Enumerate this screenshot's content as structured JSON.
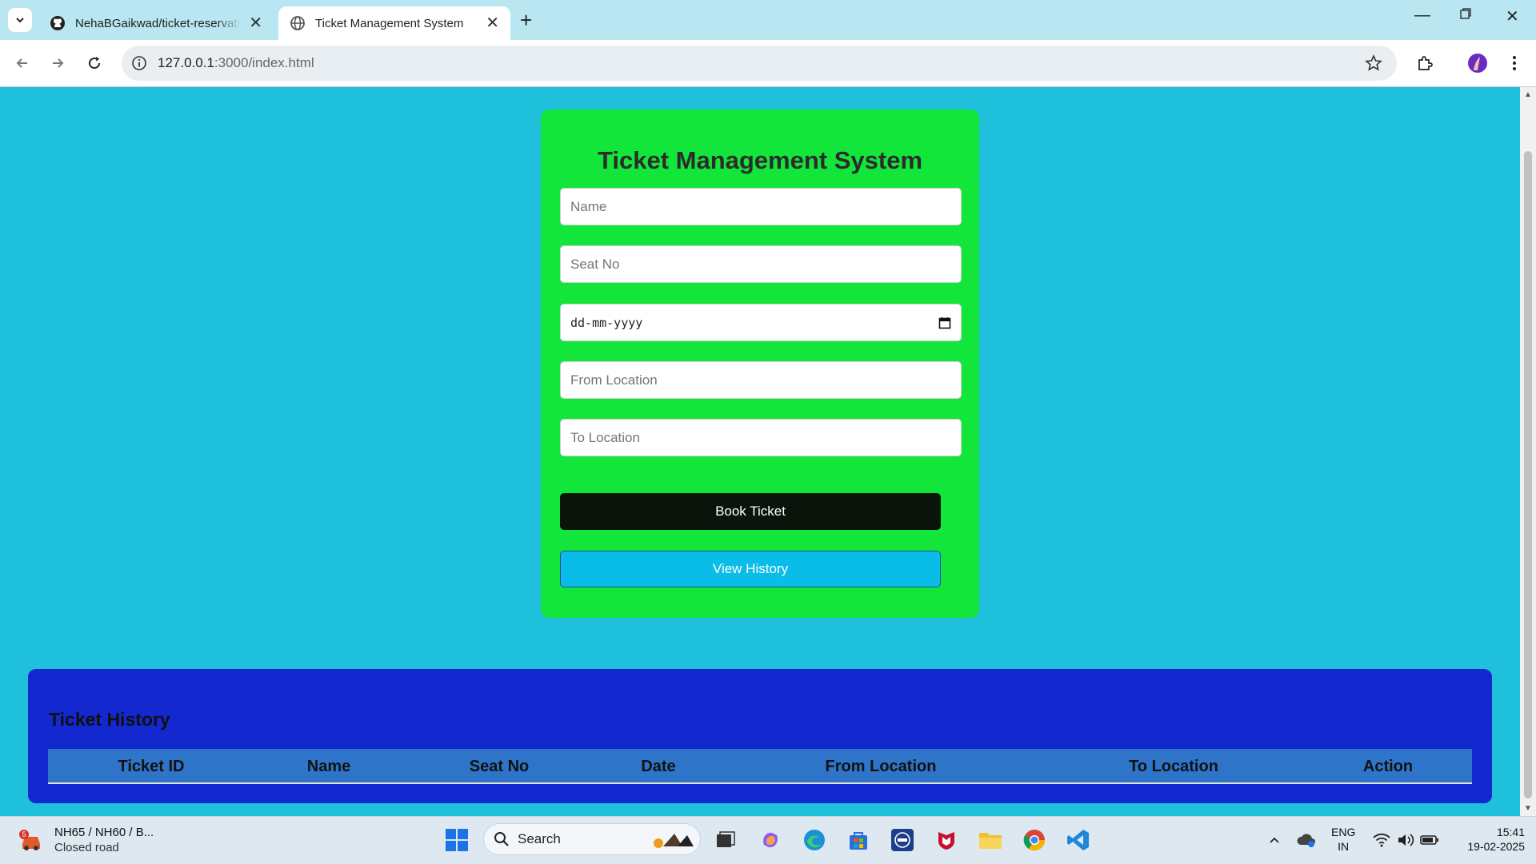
{
  "browser": {
    "tabs": [
      {
        "title": "NehaBGaikwad/ticket-reservatio",
        "active": false,
        "icon": "github-icon"
      },
      {
        "title": "Ticket Management System",
        "active": true,
        "icon": "globe-icon"
      }
    ],
    "address": {
      "host": "127.0.0.1",
      "path": ":3000/index.html"
    }
  },
  "form": {
    "title": "Ticket Management System",
    "name_placeholder": "Name",
    "seat_placeholder": "Seat No",
    "date_placeholder": "dd-mm-yyyy",
    "from_placeholder": "From Location",
    "to_placeholder": "To Location",
    "book_label": "Book Ticket",
    "history_label": "View History"
  },
  "history": {
    "title": "Ticket History",
    "columns": [
      "Ticket ID",
      "Name",
      "Seat No",
      "Date",
      "From Location",
      "To Location",
      "Action"
    ]
  },
  "taskbar": {
    "news_title": "NH65 / NH60 / B...",
    "news_sub": "Closed road",
    "news_badge": "5",
    "search_label": "Search",
    "lang_top": "ENG",
    "lang_bottom": "IN",
    "time": "15:41",
    "date": "19-02-2025"
  },
  "colors": {
    "page_bg": "#1ec0dc",
    "card_bg": "#12e63b",
    "book_btn": "#0a140a",
    "history_btn": "#0abce8",
    "history_panel": "#1428d0",
    "table_header": "#2e74c8"
  }
}
